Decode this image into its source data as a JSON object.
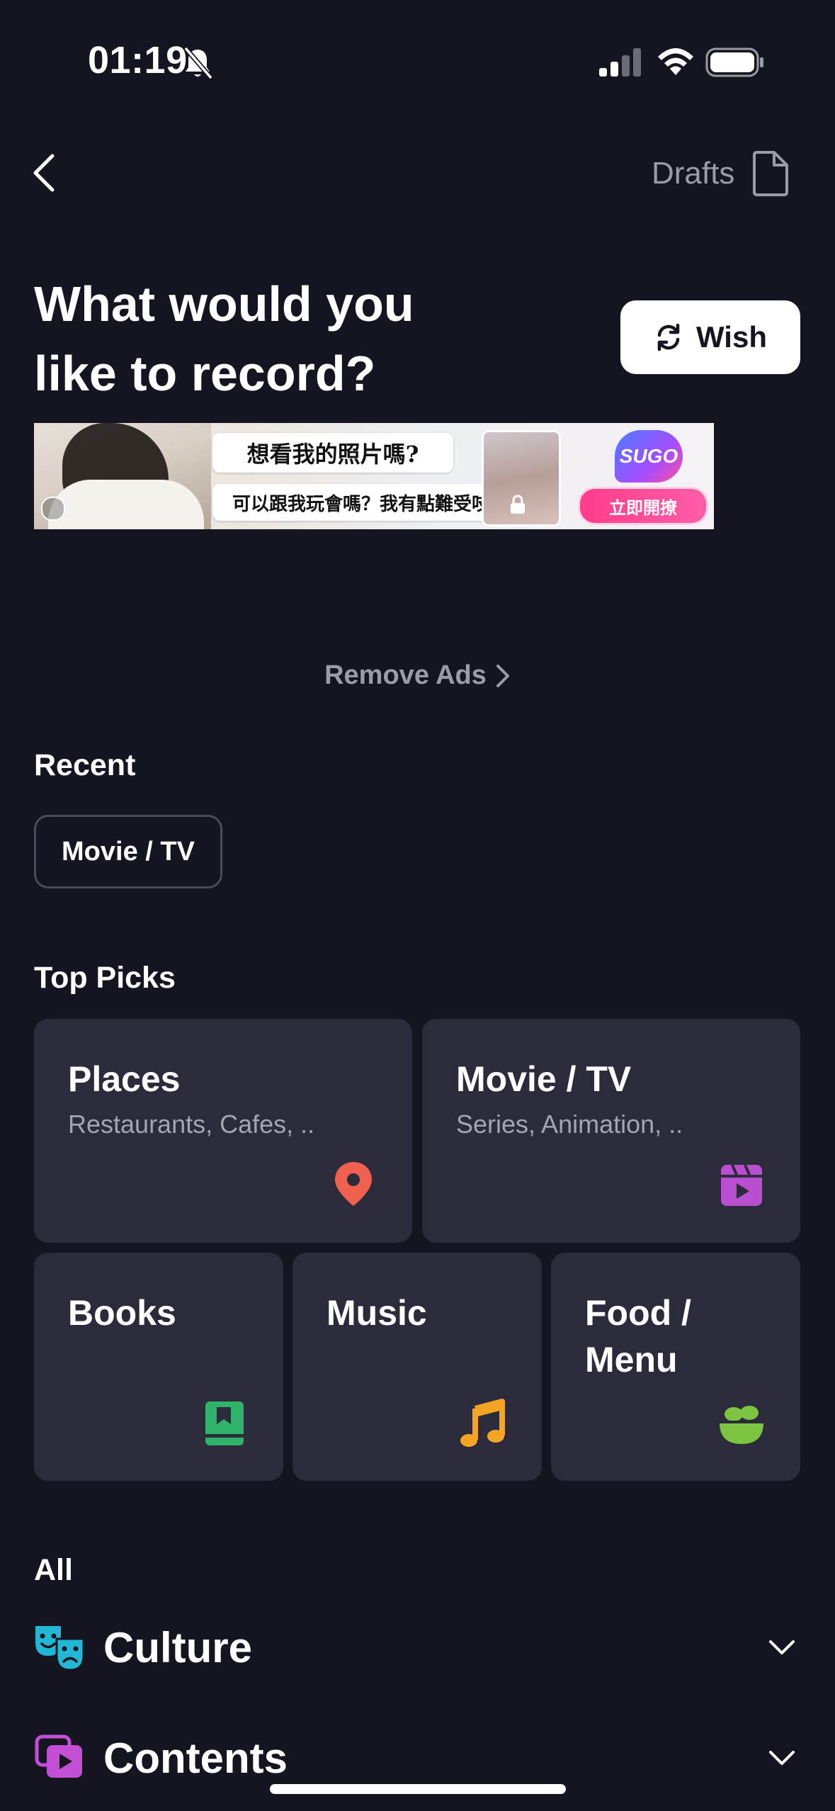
{
  "status_bar": {
    "time": "01:19"
  },
  "nav": {
    "drafts_label": "Drafts"
  },
  "header": {
    "title_line1": "What would you",
    "title_line2": "like to record?",
    "wish_label": "Wish"
  },
  "ad": {
    "bubble_1": "想看我的照片嗎?",
    "bubble_2": "可以跟我玩會嗎？我有點難受吱",
    "brand": "SUGO",
    "cta": "立即開撩"
  },
  "remove_ads_label": "Remove Ads",
  "recent": {
    "label": "Recent",
    "chips": [
      "Movie / TV"
    ]
  },
  "top_picks": {
    "label": "Top Picks",
    "cards": [
      {
        "title": "Places",
        "subtitle": "Restaurants, Cafes, ..",
        "icon": "map-pin-icon",
        "color": "#f0604f"
      },
      {
        "title": "Movie / TV",
        "subtitle": "Series, Animation, ..",
        "icon": "clapperboard-icon",
        "color": "#b94fd0"
      },
      {
        "title": "Books",
        "icon": "book-icon",
        "color": "#2fb36b"
      },
      {
        "title": "Music",
        "icon": "music-note-icon",
        "color": "#f5a524"
      },
      {
        "title": "Food / Menu",
        "title_line1": "Food /",
        "title_line2": "Menu",
        "icon": "salad-bowl-icon",
        "color": "#7cc442"
      }
    ]
  },
  "all": {
    "label": "All",
    "categories": [
      {
        "label": "Culture",
        "icon": "theater-masks-icon",
        "color": "#22b7d4"
      },
      {
        "label": "Contents",
        "icon": "media-stack-icon",
        "color": "#c24fd6"
      }
    ]
  },
  "colors": {
    "background": "#151521",
    "card": "#2b2b3b",
    "secondary_text": "#9b9ca6"
  }
}
